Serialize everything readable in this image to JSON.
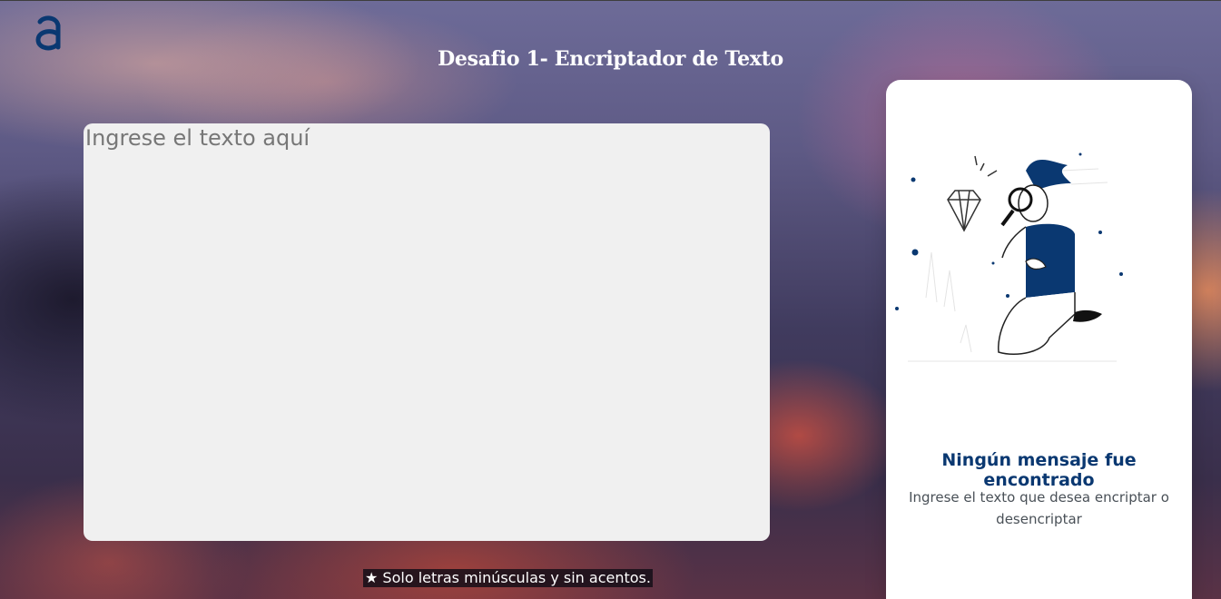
{
  "logo": {
    "icon": "alura-logo-icon",
    "color": "#0a3871"
  },
  "header": {
    "title": "Desafio 1- Encriptador de Texto"
  },
  "editor": {
    "placeholder": "Ingrese el texto aquí",
    "value": ""
  },
  "note": {
    "text": "★ Solo letras minúsculas y sin acentos."
  },
  "result_panel": {
    "illustration": "person-with-magnifier-illustration",
    "title": "Ningún mensaje fue encontrado",
    "description": "Ingrese el texto que desea encriptar o desencriptar"
  },
  "colors": {
    "brand": "#0a3871",
    "panel_bg": "#ffffff",
    "editor_bg": "#f0f0f0"
  }
}
